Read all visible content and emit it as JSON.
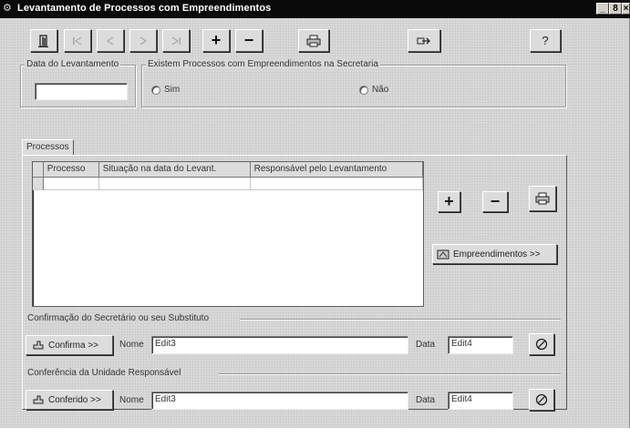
{
  "window": {
    "title": "Levantamento de Processos com Empreendimentos",
    "controls": [
      "_",
      "8",
      "×"
    ]
  },
  "toolbar": {
    "buttons": [
      {
        "name": "exit-button",
        "glyph": "door-icon"
      },
      {
        "name": "first-record-button",
        "glyph": "⏮"
      },
      {
        "name": "prior-record-button",
        "glyph": "◀"
      },
      {
        "name": "next-record-button",
        "glyph": "▶"
      },
      {
        "name": "last-record-button",
        "glyph": "⏭"
      },
      {
        "name": "insert-button",
        "glyph": "+"
      },
      {
        "name": "delete-button",
        "glyph": "−"
      },
      {
        "name": "print-button",
        "glyph": "printer-icon"
      },
      {
        "name": "refresh-button",
        "glyph": "arrow-icon"
      },
      {
        "name": "help-button",
        "glyph": "?"
      }
    ]
  },
  "levantamento": {
    "date_label": "Data do Levantamento",
    "date_value": "",
    "question": "Existem Processos com Empreendimentos na Secretaria",
    "option_yes": "Sim",
    "option_no": "Não"
  },
  "tabs": {
    "processos": "Processos"
  },
  "grid": {
    "columns": [
      "Processo",
      "Situação na data do Levant.",
      "Responsável pelo Levantamento"
    ]
  },
  "side_buttons": {
    "add": "+",
    "remove": "−",
    "empreendimentos": "Empreendimentos >>"
  },
  "confirmacao": {
    "section_label": "Confirmação do Secretário ou seu Substituto",
    "button_label": "Confirma >>",
    "nome_label": "Nome",
    "nome_value": "Edit3",
    "data_label": "Data",
    "data_value": "Edit4"
  },
  "conferencia": {
    "section_label": "Conferência da Unidade Responsável",
    "button_label": "Conferido >>",
    "nome_label": "Nome",
    "nome_value": "Edit3",
    "data_label": "Data",
    "data_value": "Edit4"
  },
  "icons": {
    "door": "door-icon",
    "printer": "printer-icon",
    "stamp": "stamp-icon",
    "cancel": "cancel-icon"
  }
}
